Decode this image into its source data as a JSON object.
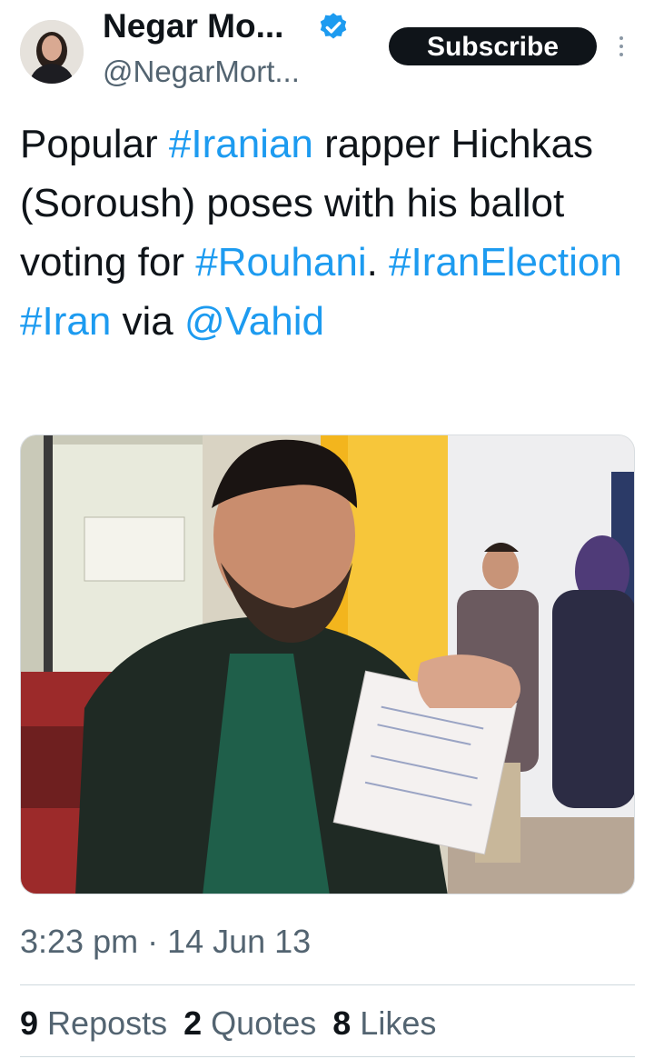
{
  "author": {
    "display_name": "Negar Mo...",
    "handle": "@NegarMort...",
    "verified": true,
    "verified_color": "#1d9bf0"
  },
  "subscribe_label": "Subscribe",
  "more_icon": "more-vertical-icon",
  "tweet": {
    "segments": [
      {
        "text": "Popular ",
        "link": false
      },
      {
        "text": "#Iranian",
        "link": true
      },
      {
        "text": " rapper Hichkas (Soroush) poses with his ballot voting for ",
        "link": false
      },
      {
        "text": "#Rouhani",
        "link": true
      },
      {
        "text": ". ",
        "link": false
      },
      {
        "text": "#IranElection",
        "link": true
      },
      {
        "text": " ",
        "link": false
      },
      {
        "text": "#Iran",
        "link": true
      },
      {
        "text": " via ",
        "link": false
      },
      {
        "text": "@Vahid",
        "link": true
      }
    ]
  },
  "timestamp": "3:23 pm · 14 Jun 13",
  "stats": {
    "reposts_count": "9",
    "reposts_label": "Reposts",
    "quotes_count": "2",
    "quotes_label": "Quotes",
    "likes_count": "8",
    "likes_label": "Likes"
  },
  "colors": {
    "link": "#1d9bf0",
    "text": "#0f1419",
    "muted": "#536471",
    "button_bg": "#0f1419"
  }
}
